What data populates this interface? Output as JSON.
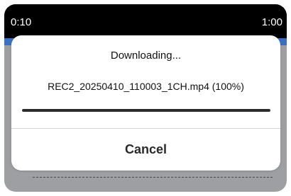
{
  "player": {
    "time_start": "0:10",
    "time_end": "1:00"
  },
  "dialog": {
    "title": "Downloading...",
    "message": "REC2_20250410_110003_1CH.mp4 (100%)",
    "progress_percent": 100,
    "cancel_label": "Cancel"
  },
  "colors": {
    "timebar_background": "#000000",
    "accent": "#3a6fc4",
    "overlay": "#9d9fa3",
    "progress_fill": "#2b2b2b"
  }
}
